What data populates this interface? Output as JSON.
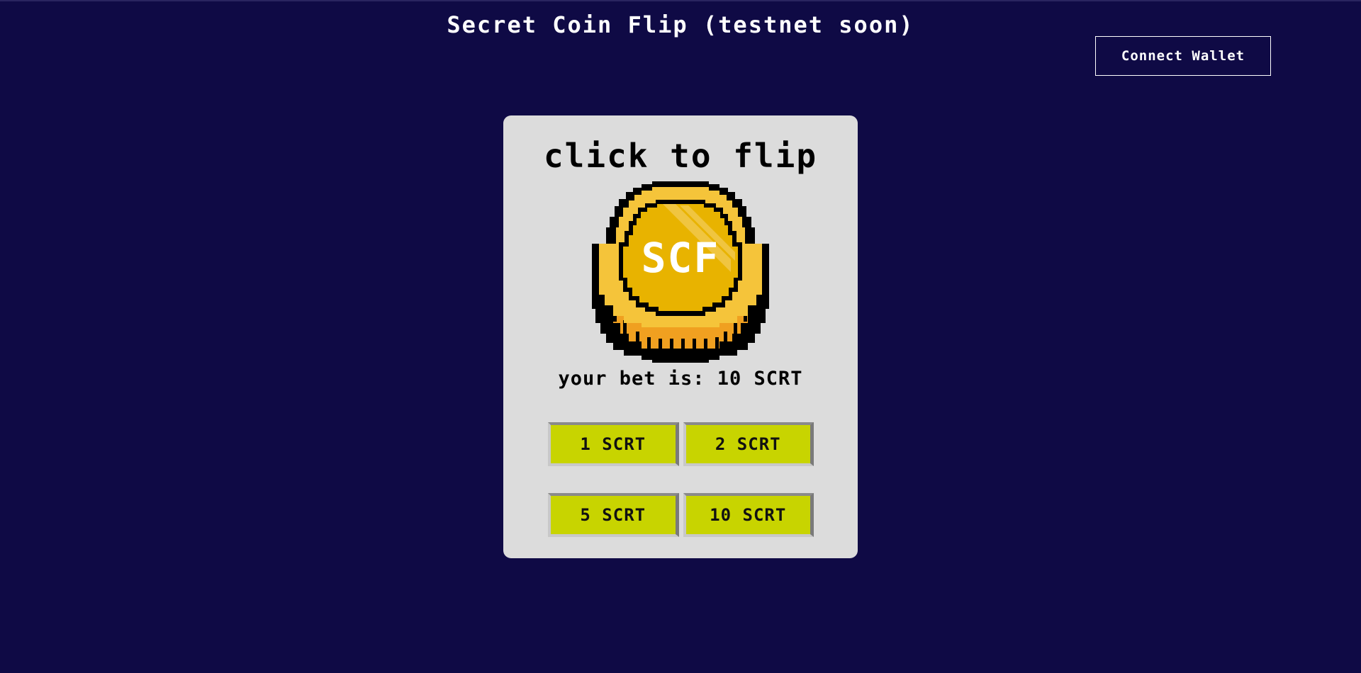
{
  "app": {
    "title": "Secret Coin Flip (testnet soon)"
  },
  "header": {
    "connect_wallet_label": "Connect Wallet"
  },
  "card": {
    "heading": "click to flip",
    "coin_text": "SCF",
    "bet_text": "your bet is: 10 SCRT",
    "bet_options": [
      {
        "label": "1 SCRT"
      },
      {
        "label": "2 SCRT"
      },
      {
        "label": "5 SCRT"
      },
      {
        "label": "10 SCRT"
      }
    ]
  },
  "colors": {
    "background": "#0f0a45",
    "card": "#dcdcdc",
    "bet_button": "#c8d400",
    "coin_gold": "#f5c43a",
    "coin_face": "#e8b300"
  }
}
